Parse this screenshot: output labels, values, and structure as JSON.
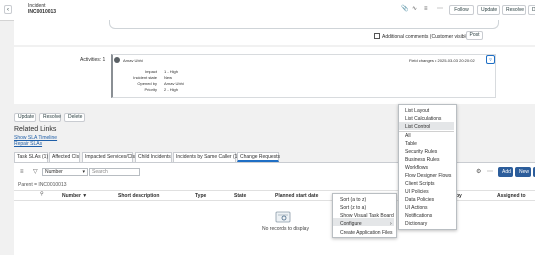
{
  "header": {
    "title": "Incident",
    "number": "INC0010013",
    "back_icon": "chevron-left-icon",
    "buttons": {
      "follow": "Follow",
      "update": "Update",
      "resolve": "Resolve",
      "delete": "De"
    }
  },
  "comments": {
    "checkbox_label": "Additional comments (Customer visible)",
    "post": "Post"
  },
  "activity": {
    "label": "Activities: 1",
    "user": "Arnav Ubhi",
    "meta": "Field changes • 2025-03-03 20:20:02",
    "fields": [
      {
        "key": "Impact",
        "value": "1 - High"
      },
      {
        "key": "Incident state",
        "value": "New"
      },
      {
        "key": "Opened by",
        "value": "Arnav Ubhi"
      },
      {
        "key": "Priority",
        "value": "2 - High"
      }
    ]
  },
  "actions": {
    "update": "Update",
    "resolve": "Resolve",
    "delete": "Delete"
  },
  "related": {
    "title": "Related Links",
    "links": [
      "Show SLA Timeline",
      "Repair SLAs"
    ]
  },
  "tabs": [
    "Task SLAs (1)",
    "Affected CIs",
    "Impacted Services/CIs",
    "Child Incidents",
    "Incidents by Same Caller (1)",
    "Change Requests"
  ],
  "list": {
    "field_select": "Number",
    "search_placeholder": "Search",
    "breadcrumb": "Parent = INC0010013",
    "new_label": "New",
    "add_label": "Add",
    "columns": [
      "Number ▼",
      "Short description",
      "Type",
      "State",
      "Planned start date",
      "by",
      "Assigned to"
    ],
    "empty": "No records to display"
  },
  "menu1": [
    "Sort (a to z)",
    "Sort (z to a)",
    "Show Visual Task Board",
    "Configure",
    "Create Application Files"
  ],
  "menu2": [
    "List Layout",
    "List Calculations",
    "List Control",
    "All",
    "Table",
    "Security Rules",
    "Business Rules",
    "Workflows",
    "Flow Designer Flows",
    "Client Scripts",
    "UI Policies",
    "Data Policies",
    "UI Actions",
    "Notifications",
    "Dictionary"
  ],
  "colors": {
    "accent": "#1f6fc5",
    "link": "#1f5fa8"
  }
}
